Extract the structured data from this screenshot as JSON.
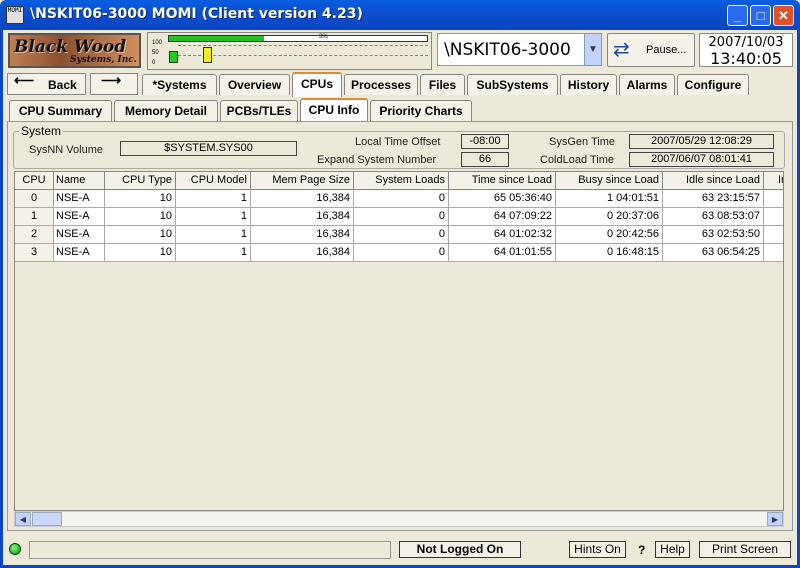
{
  "window": {
    "title": "\\NSKIT06-3000 MOMI (Client version 4.23)",
    "icon_text": "MOMI"
  },
  "logo": {
    "line1": "Black Wood",
    "line2": "Systems, Inc."
  },
  "gauge": {
    "axis": [
      "100",
      "50",
      "0"
    ],
    "percent_label": "3%",
    "busy_fraction": 0.37
  },
  "header": {
    "system": "\\NSKIT06-3000",
    "pause_label": "Pause...",
    "date": "2007/10/03",
    "time": "13:40:05"
  },
  "nav": {
    "back_label": "Back",
    "forward_icon": "forward-arrow-icon"
  },
  "main_tabs": [
    "*Systems",
    "Overview",
    "CPUs",
    "Processes",
    "Files",
    "SubSystems",
    "History",
    "Alarms",
    "Configure"
  ],
  "sub_tabs": [
    "CPU Summary",
    "Memory Detail",
    "PCBs/TLEs",
    "CPU Info",
    "Priority Charts"
  ],
  "system": {
    "legend": "System",
    "sysnn_label": "SysNN Volume",
    "sysnn_value": "$SYSTEM.SYS00",
    "lto_label": "Local Time Offset",
    "lto_value": "-08:00",
    "esn_label": "Expand System Number",
    "esn_value": "66",
    "sysgen_label": "SysGen Time",
    "sysgen_value": "2007/05/29 12:08:29",
    "coldload_label": "ColdLoad Time",
    "coldload_value": "2007/06/07 08:01:41"
  },
  "table": {
    "columns": [
      "CPU",
      "Name",
      "CPU Type",
      "CPU Model",
      "Mem Page Size",
      "System Loads",
      "Time since Load",
      "Busy since Load",
      "Idle since Load",
      "In"
    ],
    "rows": [
      [
        "0",
        "NSE-A",
        "10",
        "1",
        "16,384",
        "0",
        "65 05:36:40",
        "1 04:01:51",
        "63 23:15:57",
        ""
      ],
      [
        "1",
        "NSE-A",
        "10",
        "1",
        "16,384",
        "0",
        "64 07:09:22",
        "0 20:37:06",
        "63 08:53:07",
        ""
      ],
      [
        "2",
        "NSE-A",
        "10",
        "1",
        "16,384",
        "0",
        "64 01:02:32",
        "0 20:42:56",
        "63 02:53:50",
        ""
      ],
      [
        "3",
        "NSE-A",
        "10",
        "1",
        "16,384",
        "0",
        "64 01:01:55",
        "0 16:48:15",
        "63 06:54:25",
        ""
      ]
    ]
  },
  "status": {
    "login": "Not Logged On",
    "hints": "Hints On",
    "question": "?",
    "help": "Help",
    "print": "Print Screen"
  }
}
